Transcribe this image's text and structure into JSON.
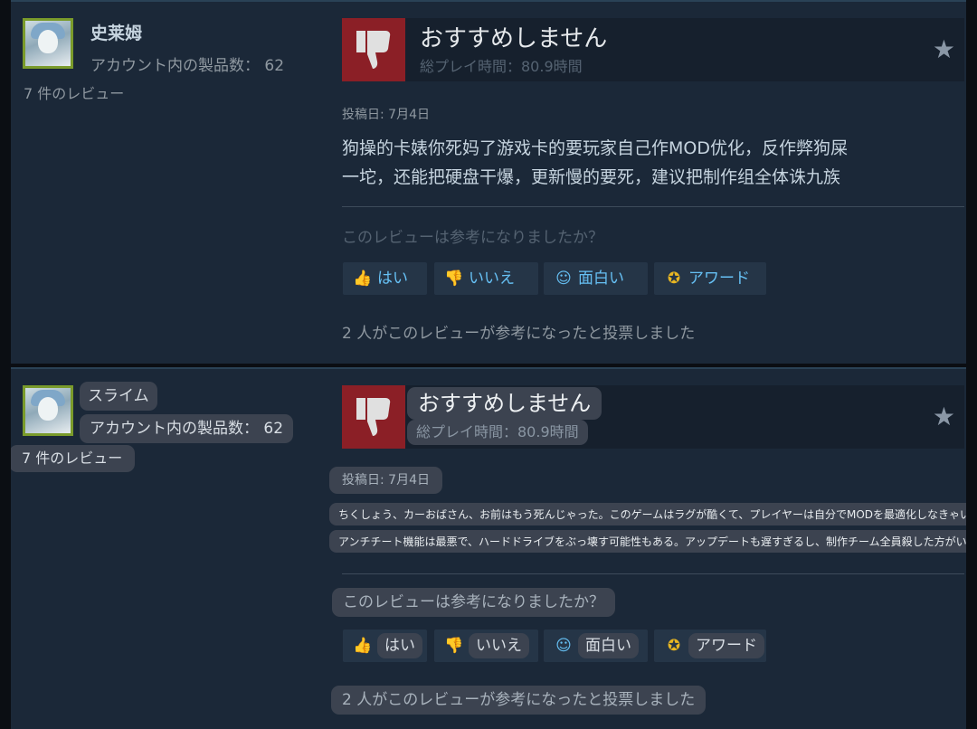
{
  "original": {
    "username": "史莱姆",
    "products": "アカウント内の製品数： 62",
    "reviews_count": "7 件のレビュー",
    "verdict": "おすすめしません",
    "playtime": "総プレイ時間：80.9時間",
    "posted": "投稿日: 7月4日",
    "body_lines": [
      "狗操的卡婊你死妈了游戏卡的要玩家自己作MOD优化，反作弊狗屎",
      "一坨，还能把硬盘干爆，更新慢的要死，建议把制作组全体诛九族"
    ],
    "question": "このレビューは参考になりましたか？",
    "buttons": {
      "yes": "はい",
      "no": "いいえ",
      "funny": "面白い",
      "award": "アワード"
    },
    "votes": "2 人がこのレビューが参考になったと投票しました"
  },
  "translated": {
    "username": "スライム",
    "products": "アカウント内の製品数： 62",
    "reviews_count": "7 件のレビュー",
    "verdict": "おすすめしません",
    "playtime": "総プレイ時間：80.9時間",
    "posted": "投稿日: 7月4日",
    "body_lines": [
      "ちくしょう、カーおばさん、お前はもう死んじゃった。このゲームはラグが酷くて、プレイヤーは自分でMODを最適化しなきゃいけない。",
      "アンチチート機能は最悪で、ハードドライブをぶっ壊す可能性もある。アップデートも遅すぎるし、制作チーム全員殺した方がいいと思う。"
    ],
    "question": "このレビューは参考になりましたか？",
    "buttons": {
      "yes": "はい",
      "no": "いいえ",
      "funny": "面白い",
      "award": "アワード"
    },
    "votes": "2 人がこのレビューが参考になったと投票しました"
  },
  "icons": {
    "thumbs_down": "thumbs-down-icon",
    "thumbs_up": "thumbs-up-icon",
    "smiley": "smiley-icon",
    "award": "award-icon",
    "star": "star-icon"
  },
  "colors": {
    "panel": "#1b2838",
    "not_recommended": "#8b1f26",
    "link_blue": "#66c0f4",
    "award_gold": "#e8b622",
    "avatar_border": "#7a9b2b"
  }
}
